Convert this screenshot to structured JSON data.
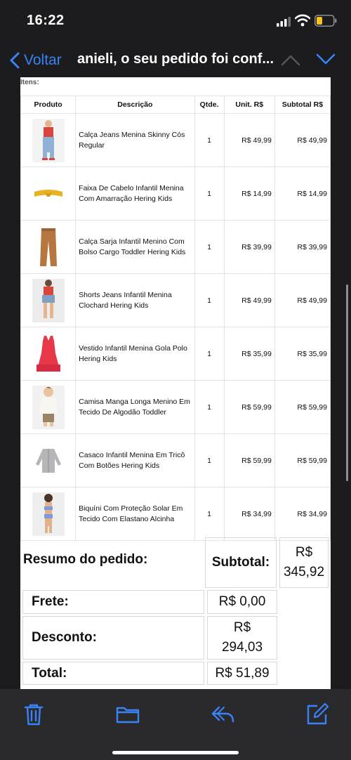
{
  "status": {
    "time": "16:22"
  },
  "nav": {
    "back_label": "Voltar",
    "title": "anieli, o seu pedido foi conf..."
  },
  "email": {
    "itens_label": "Itens:",
    "columns": {
      "produto": "Produto",
      "descricao": "Descrição",
      "qtde": "Qtde.",
      "unit": "Unit. R$",
      "subtotal": "Subtotal R$"
    },
    "items": [
      {
        "description": "Calça Jeans Menina Skinny Cós Regular",
        "qty": "1",
        "unit": "R$ 49,99",
        "subtotal": "R$ 49,99",
        "thumb": "jeans"
      },
      {
        "description": "Faixa De Cabelo Infantil Menina Com Amarração Hering Kids",
        "qty": "1",
        "unit": "R$ 14,99",
        "subtotal": "R$ 14,99",
        "thumb": "headband"
      },
      {
        "description": "Calça Sarja Infantil Menino Com Bolso Cargo Toddler Hering Kids",
        "qty": "1",
        "unit": "R$ 39,99",
        "subtotal": "R$ 39,99",
        "thumb": "pants"
      },
      {
        "description": "Shorts Jeans Infantil Menina Clochard Hering Kids",
        "qty": "1",
        "unit": "R$ 49,99",
        "subtotal": "R$ 49,99",
        "thumb": "shorts"
      },
      {
        "description": "Vestido Infantil Menina Gola Polo Hering Kids",
        "qty": "1",
        "unit": "R$ 35,99",
        "subtotal": "R$ 35,99",
        "thumb": "dress"
      },
      {
        "description": "Camisa Manga Longa Menino Em Tecido De Algodão Toddler",
        "qty": "1",
        "unit": "R$ 59,99",
        "subtotal": "R$ 59,99",
        "thumb": "shirt"
      },
      {
        "description": "Casaco Infantil Menina Em Tricô Com Botões Hering Kids",
        "qty": "1",
        "unit": "R$ 59,99",
        "subtotal": "R$ 59,99",
        "thumb": "cardigan"
      },
      {
        "description": "Biquíni Com Proteção Solar Em Tecido Com Elastano Alcinha",
        "qty": "1",
        "unit": "R$ 34,99",
        "subtotal": "R$ 34,99",
        "thumb": "bikini"
      }
    ],
    "summary": {
      "title": "Resumo do pedido:",
      "subtotal_label": "Subtotal:",
      "subtotal_value": "R$ 345,92",
      "frete_label": "Frete:",
      "frete_value": "R$ 0,00",
      "desconto_label": "Desconto:",
      "desconto_value": "R$ 294,03",
      "total_label": "Total:",
      "total_value": "R$ 51,89"
    }
  },
  "toolbar": {
    "icons": [
      "trash-icon",
      "folder-icon",
      "reply-icon",
      "compose-icon"
    ]
  },
  "colors": {
    "accent": "#3a82f7",
    "background": "#1c1c1e",
    "toolbar": "#2a2a2c"
  }
}
